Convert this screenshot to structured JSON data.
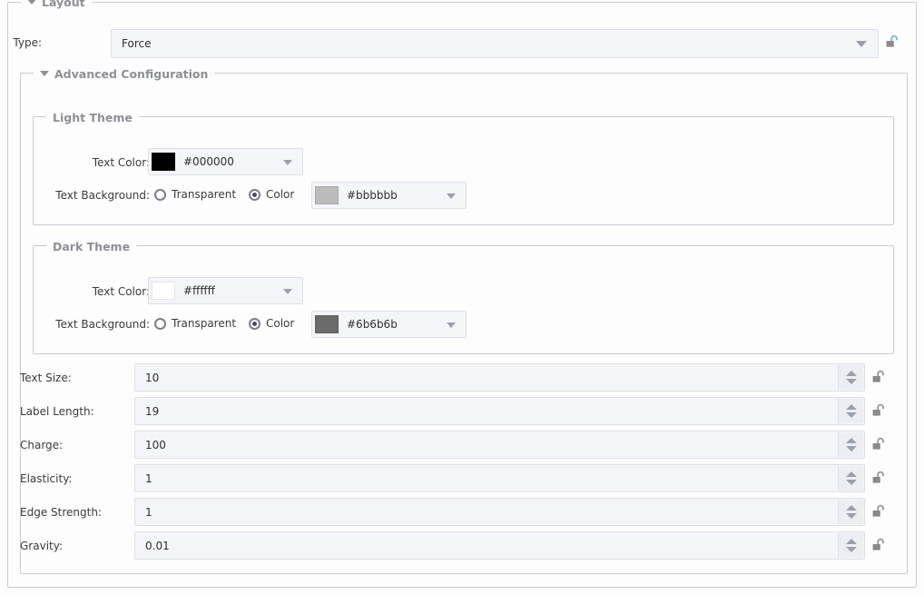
{
  "panel": {
    "layout_group_legend": "Layout",
    "advanced_group_legend": "Advanced Configuration",
    "light_theme_legend": "Light Theme",
    "dark_theme_legend": "Dark Theme"
  },
  "type_row": {
    "label": "Type:",
    "value": "Force",
    "lock_icon": "unlock-icon",
    "dropdown_icon": "chevron-down-icon"
  },
  "light_theme": {
    "text_color": {
      "label": "Text Color:",
      "value": "#000000",
      "swatch": "#000000"
    },
    "text_background": {
      "label": "Text Background:",
      "transparent_label": "Transparent",
      "color_label": "Color",
      "selected": "Color",
      "value": "#bbbbbb",
      "swatch": "#bbbbbb"
    }
  },
  "dark_theme": {
    "text_color": {
      "label": "Text Color:",
      "value": "#ffffff",
      "swatch": "#ffffff"
    },
    "text_background": {
      "label": "Text Background:",
      "transparent_label": "Transparent",
      "color_label": "Color",
      "selected": "Color",
      "value": "#6b6b6b",
      "swatch": "#6b6b6b"
    }
  },
  "numeric_fields": [
    {
      "label": "Text Size:",
      "value": "10",
      "lock_icon": "unlock-icon",
      "spinner_icon": "spinner-up-down-icon"
    },
    {
      "label": "Label Length:",
      "value": "19",
      "lock_icon": "unlock-icon",
      "spinner_icon": "spinner-up-down-icon"
    },
    {
      "label": "Charge:",
      "value": "100",
      "lock_icon": "unlock-icon",
      "spinner_icon": "spinner-up-down-icon"
    },
    {
      "label": "Elasticity:",
      "value": "1",
      "lock_icon": "unlock-icon",
      "spinner_icon": "spinner-up-down-icon"
    },
    {
      "label": "Edge Strength:",
      "value": "1",
      "lock_icon": "unlock-icon",
      "spinner_icon": "spinner-up-down-icon"
    },
    {
      "label": "Gravity:",
      "value": "0.01",
      "lock_icon": "unlock-icon",
      "spinner_icon": "spinner-up-down-icon"
    }
  ],
  "colors": {
    "border": "#c8cbd2",
    "field_bg": "#f4f5f9",
    "field_border": "#dcdfe6",
    "legend_text": "#8d8f96",
    "label_text": "#3b3b3b",
    "lock_body": "#8a8a8a",
    "lock_shackle": "#7fb3e0"
  }
}
